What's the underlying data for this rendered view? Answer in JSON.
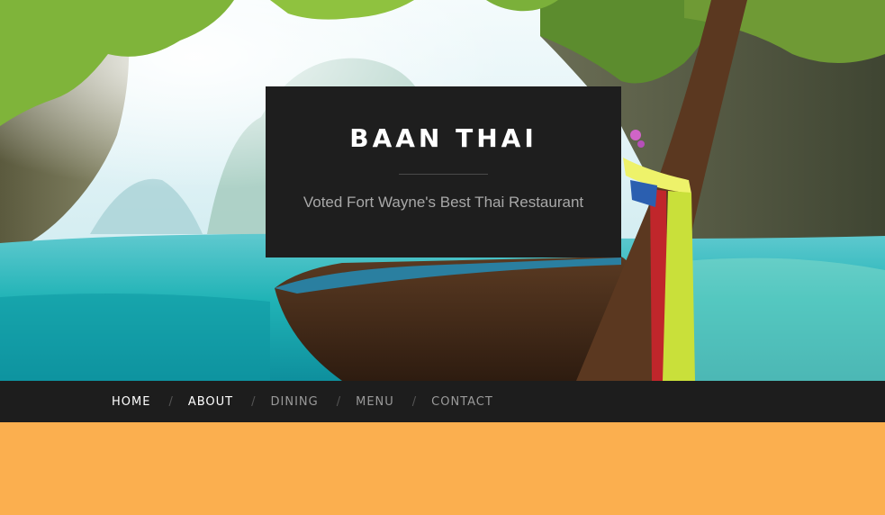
{
  "site": {
    "title": "BAAN THAI",
    "tagline": "Voted Fort Wayne's Best Thai Restaurant"
  },
  "nav": {
    "items": [
      {
        "label": "HOME",
        "active": true
      },
      {
        "label": "ABOUT",
        "active": true
      },
      {
        "label": "DINING",
        "active": false
      },
      {
        "label": "MENU",
        "active": false
      },
      {
        "label": "CONTACT",
        "active": false
      }
    ],
    "separator": "/"
  },
  "colors": {
    "title_box_bg": "#1e1e1e",
    "nav_bg": "#1d1d1d",
    "content_bg": "#fbaf4f",
    "water": "#1fb5b0",
    "sky": "#dff2f4"
  },
  "hero": {
    "image": "tropical-beach-longtail-boat"
  }
}
